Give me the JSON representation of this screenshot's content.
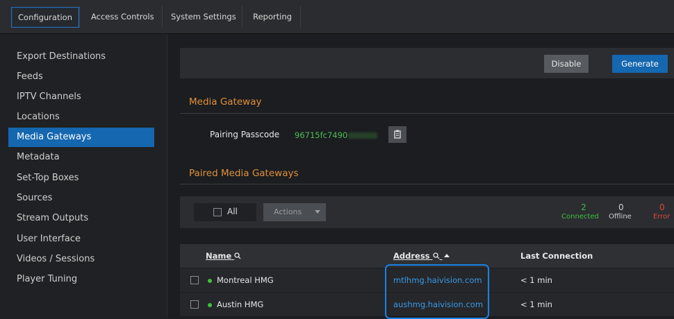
{
  "tabs": [
    {
      "label": "Configuration",
      "active": true
    },
    {
      "label": "Access Controls"
    },
    {
      "label": "System Settings"
    },
    {
      "label": "Reporting"
    }
  ],
  "sidebar": {
    "items": [
      {
        "label": "Export Destinations"
      },
      {
        "label": "Feeds"
      },
      {
        "label": "IPTV Channels"
      },
      {
        "label": "Locations"
      },
      {
        "label": "Media Gateways",
        "active": true
      },
      {
        "label": "Metadata"
      },
      {
        "label": "Set-Top Boxes"
      },
      {
        "label": "Sources"
      },
      {
        "label": "Stream Outputs"
      },
      {
        "label": "User Interface"
      },
      {
        "label": "Videos / Sessions"
      },
      {
        "label": "Player Tuning"
      }
    ]
  },
  "toolbar": {
    "disable_label": "Disable",
    "generate_label": "Generate"
  },
  "media_gateway": {
    "section_title": "Media Gateway",
    "pairing_label": "Pairing Passcode",
    "passcode_visible": "96715fc7490"
  },
  "paired": {
    "section_title": "Paired Media Gateways",
    "all_label": "All",
    "actions_label": "Actions",
    "stats": {
      "connected_count": "2",
      "connected_label": "Connected",
      "offline_count": "0",
      "offline_label": "Offline",
      "error_count": "0",
      "error_label": "Error"
    },
    "columns": {
      "name": "Name",
      "address": "Address",
      "last_connection": "Last Connection"
    },
    "rows": [
      {
        "name": "Montreal HMG",
        "address": "mtlhmg.haivision.com",
        "last_connection": "< 1 min"
      },
      {
        "name": "Austin HMG",
        "address": "aushmg.haivision.com",
        "last_connection": "< 1 min"
      }
    ]
  },
  "colors": {
    "accent": "#1567b0",
    "section_title": "#e1903a",
    "link": "#3a9be8",
    "online": "#3fc13f",
    "error": "#e0453a",
    "highlight_box": "#1a82e6"
  }
}
